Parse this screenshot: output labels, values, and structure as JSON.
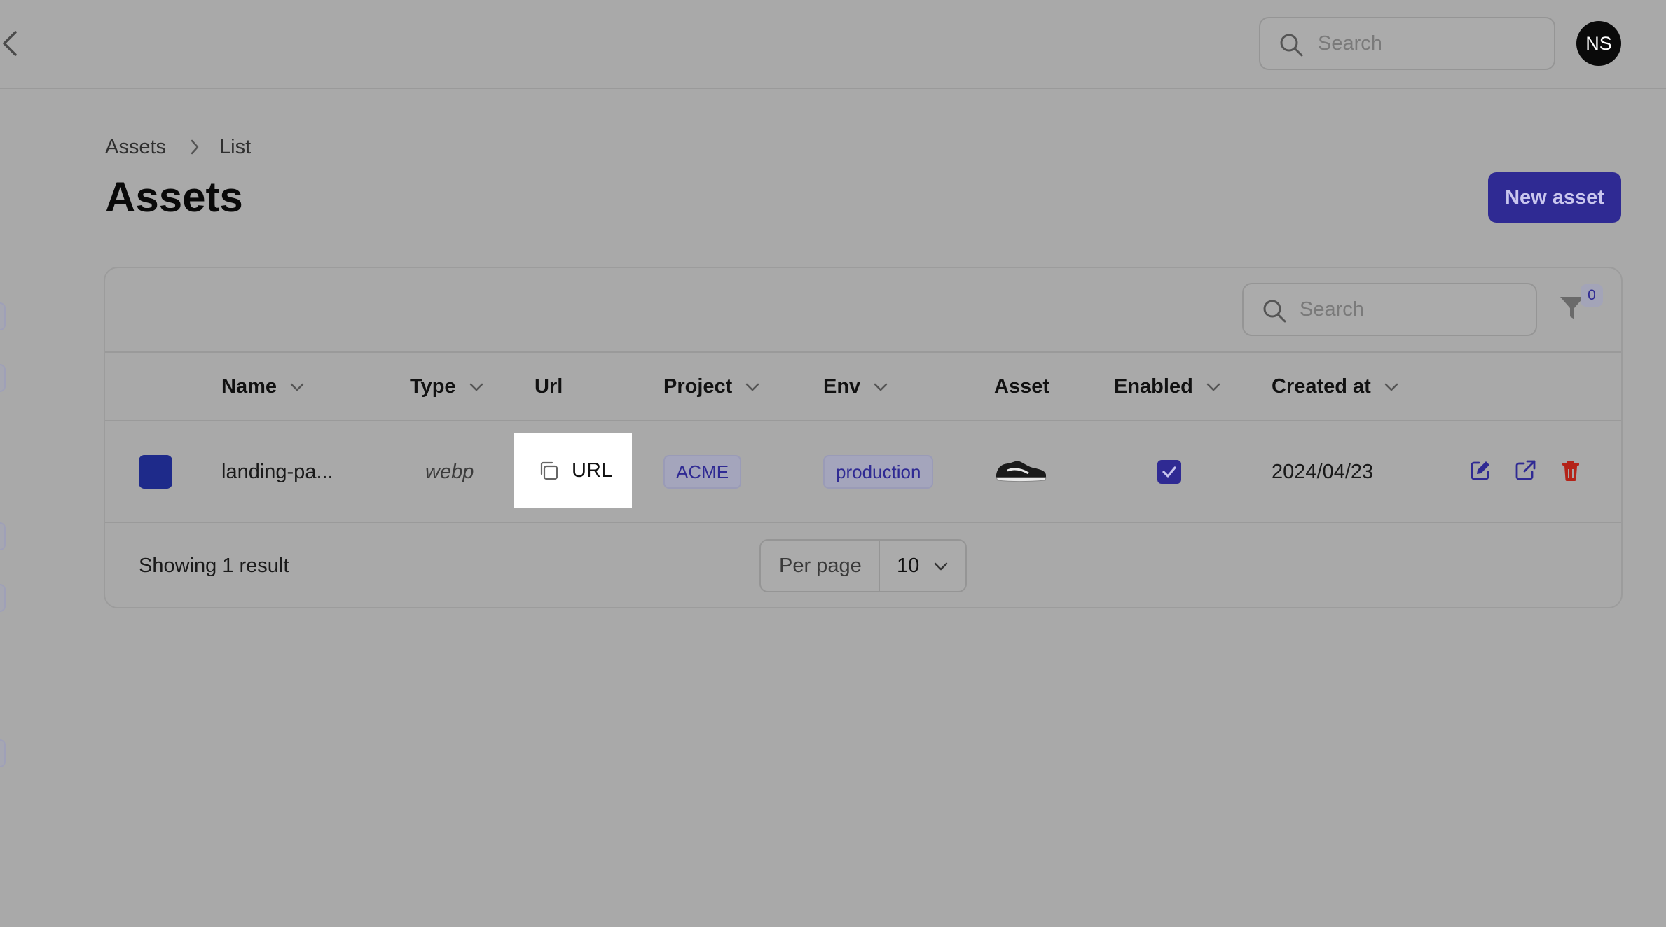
{
  "topbar": {
    "search_placeholder": "Search",
    "avatar_initials": "NS"
  },
  "breadcrumb": {
    "items": [
      "Assets",
      "List"
    ]
  },
  "page": {
    "title": "Assets",
    "new_button_label": "New asset"
  },
  "table": {
    "search_placeholder": "Search",
    "filter_count": "0",
    "columns": [
      "Name",
      "Type",
      "Url",
      "Project",
      "Env",
      "Asset",
      "Enabled",
      "Created at"
    ],
    "rows": [
      {
        "name": "landing-pa...",
        "type": "webp",
        "url_label": "URL",
        "project": "ACME",
        "env": "production",
        "asset_icon": "sneaker-image",
        "enabled": true,
        "created_at": "2024/04/23"
      }
    ],
    "footer": {
      "summary": "Showing 1 result",
      "per_page_label": "Per page",
      "per_page_value": "10"
    }
  },
  "colors": {
    "accent": "#2f2a93",
    "delete": "#b42318",
    "overlay_bg": "#a9a9a9"
  }
}
